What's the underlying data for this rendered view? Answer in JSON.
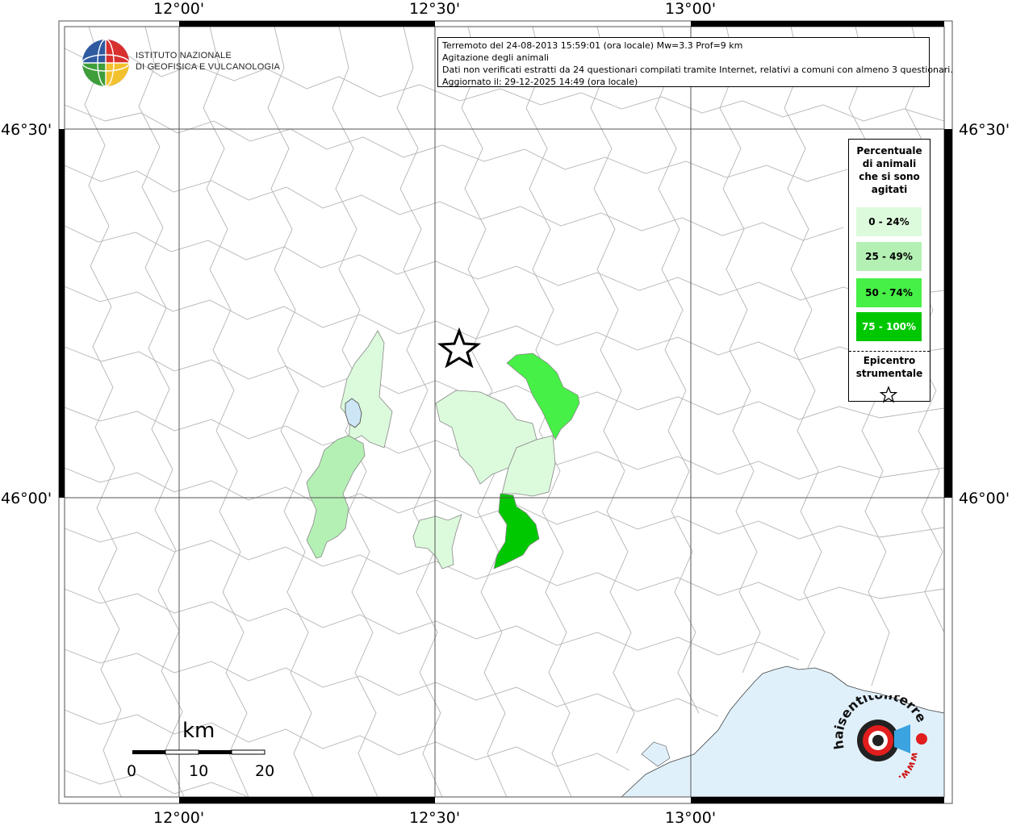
{
  "map": {
    "lat_labels": [
      "46°30'",
      "46°00'"
    ],
    "lon_labels": [
      "12°00'",
      "12°30'",
      "13°00'"
    ]
  },
  "logo": {
    "line1": "ISTITUTO NAZIONALE",
    "line2": "DI GEOFISICA E VULCANOLOGIA"
  },
  "info": {
    "line1": "Terremoto del 24-08-2013 15:59:01 (ora locale) Mw=3.3 Prof=9 km",
    "line2": "Agitazione degli animali",
    "line3": "Dati non verificati estratti da 24 questionari compilati tramite Internet, relativi a comuni con almeno 3 questionari.",
    "line4": "Aggiornato il: 29-12-2025 14:49 (ora locale)"
  },
  "legend": {
    "title_line1": "Percentuale",
    "title_line2": "di animali",
    "title_line3": "che si sono",
    "title_line4": "agitati",
    "classes": [
      {
        "label": "0 - 24%",
        "color": "#dcfadc"
      },
      {
        "label": "25 - 49%",
        "color": "#b4f0b4"
      },
      {
        "label": "50 - 74%",
        "color": "#46f046"
      },
      {
        "label": "75 - 100%",
        "color": "#00c800"
      }
    ],
    "epicenter_line1": "Epicentro",
    "epicenter_line2": "strumentale"
  },
  "scalebar": {
    "unit": "km",
    "ticks": [
      "0",
      "10",
      "20"
    ]
  },
  "watermark": {
    "text1": "haisentitoilterremoto.it",
    "text2": "www."
  },
  "colors": {
    "border": "#6e6e6e",
    "grid": "#555555",
    "sea": "#dff0fb",
    "lake": "#cde6f5",
    "boundary": "#b4b4b4"
  }
}
